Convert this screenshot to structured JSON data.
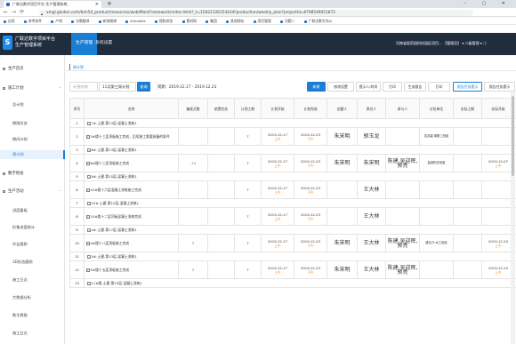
{
  "browser": {
    "tab_title": "广联达数字项目平台-生产管理系统",
    "new_tab": "+",
    "window_controls": "– ▢ ✕",
    "url": "xmgl.glodon.com/bim5d_product/resources/web/MainFramework/index.html?_t=1592212615443#/production/weekly_plan?projectId=8798549051872",
    "bookmarks": [
      "应用",
      "参考软件",
      "产线",
      "谷歌翻译",
      "新浪微博",
      "Alimobile",
      "搜狗浏览",
      "素材网",
      "集团",
      "其他网站",
      "项目管理",
      "问题二",
      "广联达数字办公"
    ]
  },
  "app": {
    "system_name_line1": "广联达数字项目平台",
    "system_name_line2": "生产管理系统",
    "nav": [
      "生产管理",
      "系统设置"
    ],
    "header_info": "河南省医药园科技园区项目... 【管理员】  ▾   二级管理 ▾  ⓘ"
  },
  "sidebar": {
    "groups": [
      {
        "label": "生产首页",
        "caret": ""
      },
      {
        "label": "施工计划",
        "caret": "^"
      },
      {
        "label": "数字例会",
        "caret": ""
      },
      {
        "label": "生产活动",
        "caret": "^"
      }
    ],
    "plan_items": [
      "总计划",
      "期限任务",
      "期间计划",
      "周计划"
    ],
    "activity_items": [
      "进度看板",
      "形象进度统计",
      "作业跟踪",
      "3D形态跟踪",
      "施工日志",
      "大数据分析",
      "数字周报",
      "施工日志"
    ]
  },
  "page": {
    "breadcrumb": "周计划",
    "search_placeholder": "计划名称",
    "week_select": "11月第三周计划",
    "query_button": "查询",
    "period": "周期：2019.12.17 - 2019.12.23",
    "toolbar": [
      "新建",
      "修改设置",
      "提示人/时间",
      "打印",
      "生成报告",
      "打印",
      "报告任务提示",
      "报告任务提示"
    ]
  },
  "table": {
    "headers": [
      "序号",
      "名称",
      "偏差天数",
      "前置任务",
      "计划工期",
      "计划开始",
      "计划完成",
      "创建人",
      "责任人",
      "参与人",
      "分包单位",
      "实际工期",
      "实际开始",
      "实际完成"
    ],
    "rows": [
      {
        "type": "group",
        "no": "1",
        "name": "7#-土建-第13层-混凝土浇筑1"
      },
      {
        "type": "item",
        "no": "2",
        "name": "3#楼十三层顶板施工完成，后续施工需要具备的条件",
        "dev": "",
        "pre": "",
        "dur": "7",
        "start": "2019-12-17",
        "start_sub": "上午",
        "end": "2019-12-23",
        "end_sub": "下午",
        "creator": "朱宋明",
        "owner": "郭玉龙",
        "participants": "",
        "sub": "凯凯建 钢筋工班组",
        "act_dur": "",
        "act_start": "",
        "act_end": ""
      },
      {
        "type": "group",
        "no": "3",
        "name": "8#-土建-第13层-混凝土浇筑1"
      },
      {
        "type": "item",
        "no": "4",
        "name": "8#楼十三层顶板施工完成",
        "dev": "-10",
        "pre": "",
        "dur": "7",
        "start": "2019-12-17",
        "start_sub": "上午",
        "end": "2019-12-23",
        "end_sub": "下午",
        "creator": "朱宋明",
        "owner": "朱宋明",
        "participants": "陈建,吴迎晖,郭亮",
        "sub": "盐城阳光班组",
        "act_dur": "",
        "act_start": "2019-12-07",
        "act_start_sub": "上午",
        "act_end": ""
      },
      {
        "type": "group",
        "no": "5",
        "name": "9#-土建-第15层-混凝土浇筑1"
      },
      {
        "type": "item",
        "no": "6",
        "name": "10#楼十六层混凝土浇筑施工完成",
        "dev": "",
        "pre": "",
        "dur": "7",
        "start": "2019-12-17",
        "start_sub": "上午",
        "end": "2019-12-23",
        "end_sub": "下午",
        "creator": "",
        "owner": "王大林",
        "participants": "",
        "sub": "",
        "act_dur": "",
        "act_start": "",
        "act_end": ""
      },
      {
        "type": "group",
        "no": "7",
        "name": "10#-土建-第12层-混凝土浇筑1"
      },
      {
        "type": "item",
        "no": "8",
        "name": "10#楼十二层顶板混凝土浇筑完成",
        "dev": "",
        "pre": "",
        "dur": "7",
        "start": "2019-12-17",
        "start_sub": "上午",
        "end": "2019-12-23",
        "end_sub": "下午",
        "creator": "",
        "owner": "王大林",
        "participants": "",
        "sub": "",
        "act_dur": "",
        "act_start": "",
        "act_end": ""
      },
      {
        "type": "group",
        "no": "9",
        "name": "4#-土建-第17层-混凝土浇筑1"
      },
      {
        "type": "item",
        "no": "10",
        "name": "4#楼十八层顶板施工完成",
        "dev": "3",
        "pre": "",
        "dur": "7",
        "start": "2019-12-17",
        "start_sub": "上午",
        "end": "2019-12-23",
        "end_sub": "下午",
        "creator": "朱宋明",
        "owner": "王大林",
        "participants": "陈建,吴迎晖,郭亮",
        "sub": "盛业兴·木工班组",
        "act_dur": "",
        "act_start": "2019-12-20",
        "act_start_sub": "上午",
        "act_end": ""
      },
      {
        "type": "group",
        "no": "11",
        "name": "5#-土建-第13层-混凝土浇筑1"
      },
      {
        "type": "item",
        "no": "12",
        "name": "5#楼十五层顶板施工完成",
        "dev": "3",
        "pre": "",
        "dur": "7",
        "start": "2019-12-17",
        "start_sub": "上午",
        "end": "2019-12-23",
        "end_sub": "下午",
        "creator": "朱宋明",
        "owner": "王大林",
        "participants": "陈建,吴迎晖,郭亮",
        "sub": "",
        "act_dur": "",
        "act_start": "2019-12-20",
        "act_start_sub": "上午",
        "act_end": ""
      },
      {
        "type": "group",
        "no": "13",
        "name": "11#楼-土建-第15层-混凝土浇筑1"
      }
    ]
  },
  "colors": {
    "primary": "#1a7fd4",
    "header_bg": "#1f2d3d",
    "negative": "#e03e3e",
    "positive": "#3aa03a",
    "am_label": "#f08a24"
  },
  "icons": [
    "back-icon",
    "forward-icon",
    "reload-icon",
    "lock-icon",
    "expand-icon",
    "chevron-up-icon"
  ]
}
